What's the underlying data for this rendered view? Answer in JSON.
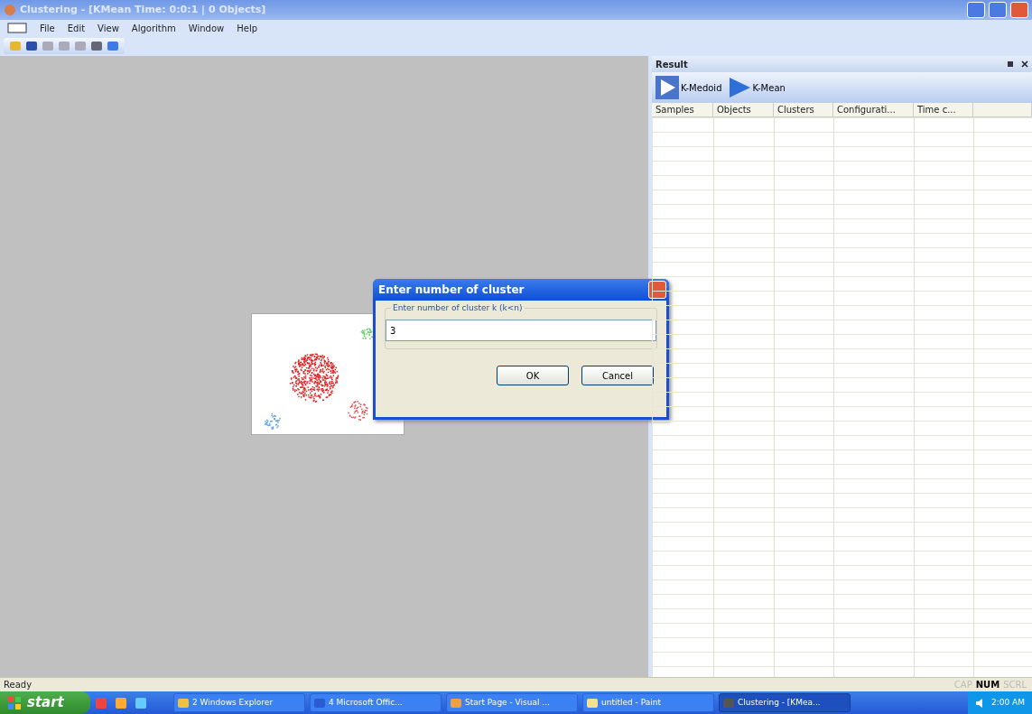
{
  "window": {
    "title": "Clustering - [KMean Time: 0:0:1 | 0 Objects]"
  },
  "menu": [
    "File",
    "Edit",
    "View",
    "Algorithm",
    "Window",
    "Help"
  ],
  "result_panel": {
    "title": "Result",
    "tools": [
      "K-Medoid",
      "K-Mean"
    ],
    "columns": [
      "Samples",
      "Objects",
      "Clusters",
      "Configurati...",
      "Time c..."
    ]
  },
  "dialog": {
    "title": "Enter number of cluster",
    "group_label": "Enter number of cluster k (k<n)",
    "value": "3",
    "buttons": [
      "OK",
      "Cancel"
    ]
  },
  "status_bar": {
    "text": "Ready",
    "indicators": [
      {
        "label": "CAP",
        "on": false
      },
      {
        "label": "NUM",
        "on": true
      },
      {
        "label": "SCRL",
        "on": false
      }
    ]
  },
  "taskbar": {
    "start": "start",
    "tasks": [
      {
        "label": "2 Windows Explorer",
        "selected": false
      },
      {
        "label": "4 Microsoft Offic...",
        "selected": false
      },
      {
        "label": "Start Page - Visual ...",
        "selected": false
      },
      {
        "label": "untitled - Paint",
        "selected": false
      },
      {
        "label": "Clustering - [KMea...",
        "selected": true
      }
    ],
    "clock": "2:00 AM"
  }
}
